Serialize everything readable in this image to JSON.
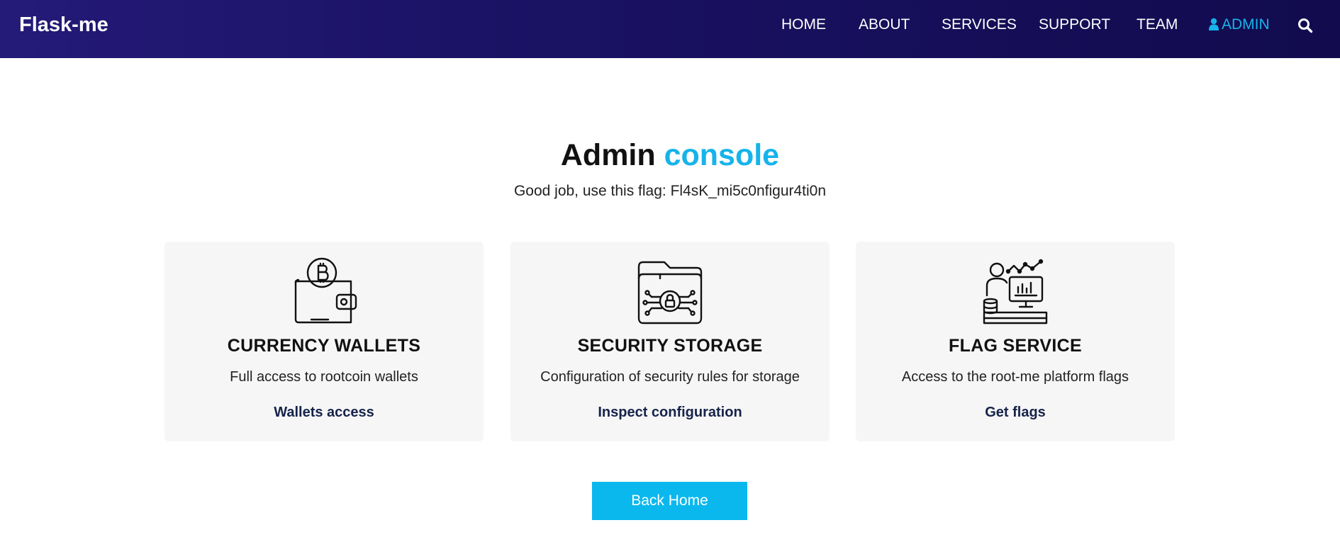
{
  "brand": "Flask-me",
  "nav": {
    "items": [
      {
        "label": "HOME"
      },
      {
        "label": "ABOUT"
      },
      {
        "label": "SERVICES"
      },
      {
        "label": "SUPPORT"
      },
      {
        "label": "TEAM"
      },
      {
        "label": "ADMIN",
        "active": true
      }
    ],
    "search_icon": "search-icon",
    "admin_icon": "user-icon"
  },
  "hero": {
    "title_main": "Admin",
    "title_accent": "console",
    "subtitle": "Good job, use this flag: Fl4sK_mi5c0nfigur4ti0n"
  },
  "cards": [
    {
      "icon": "bitcoin-wallet-icon",
      "title": "CURRENCY WALLETS",
      "description": "Full access to rootcoin wallets",
      "link": "Wallets access"
    },
    {
      "icon": "secure-folder-icon",
      "title": "SECURITY STORAGE",
      "description": "Configuration of security rules for storage",
      "link": "Inspect configuration"
    },
    {
      "icon": "analytics-user-icon",
      "title": "FLAG SERVICE",
      "description": "Access to the root-me platform flags",
      "link": "Get flags"
    }
  ],
  "back_button": "Back Home",
  "colors": {
    "navbar": "#1a1263",
    "accent": "#17b3ea",
    "button": "#0ab8ee",
    "card_bg": "#f6f6f6",
    "link": "#16234a"
  }
}
